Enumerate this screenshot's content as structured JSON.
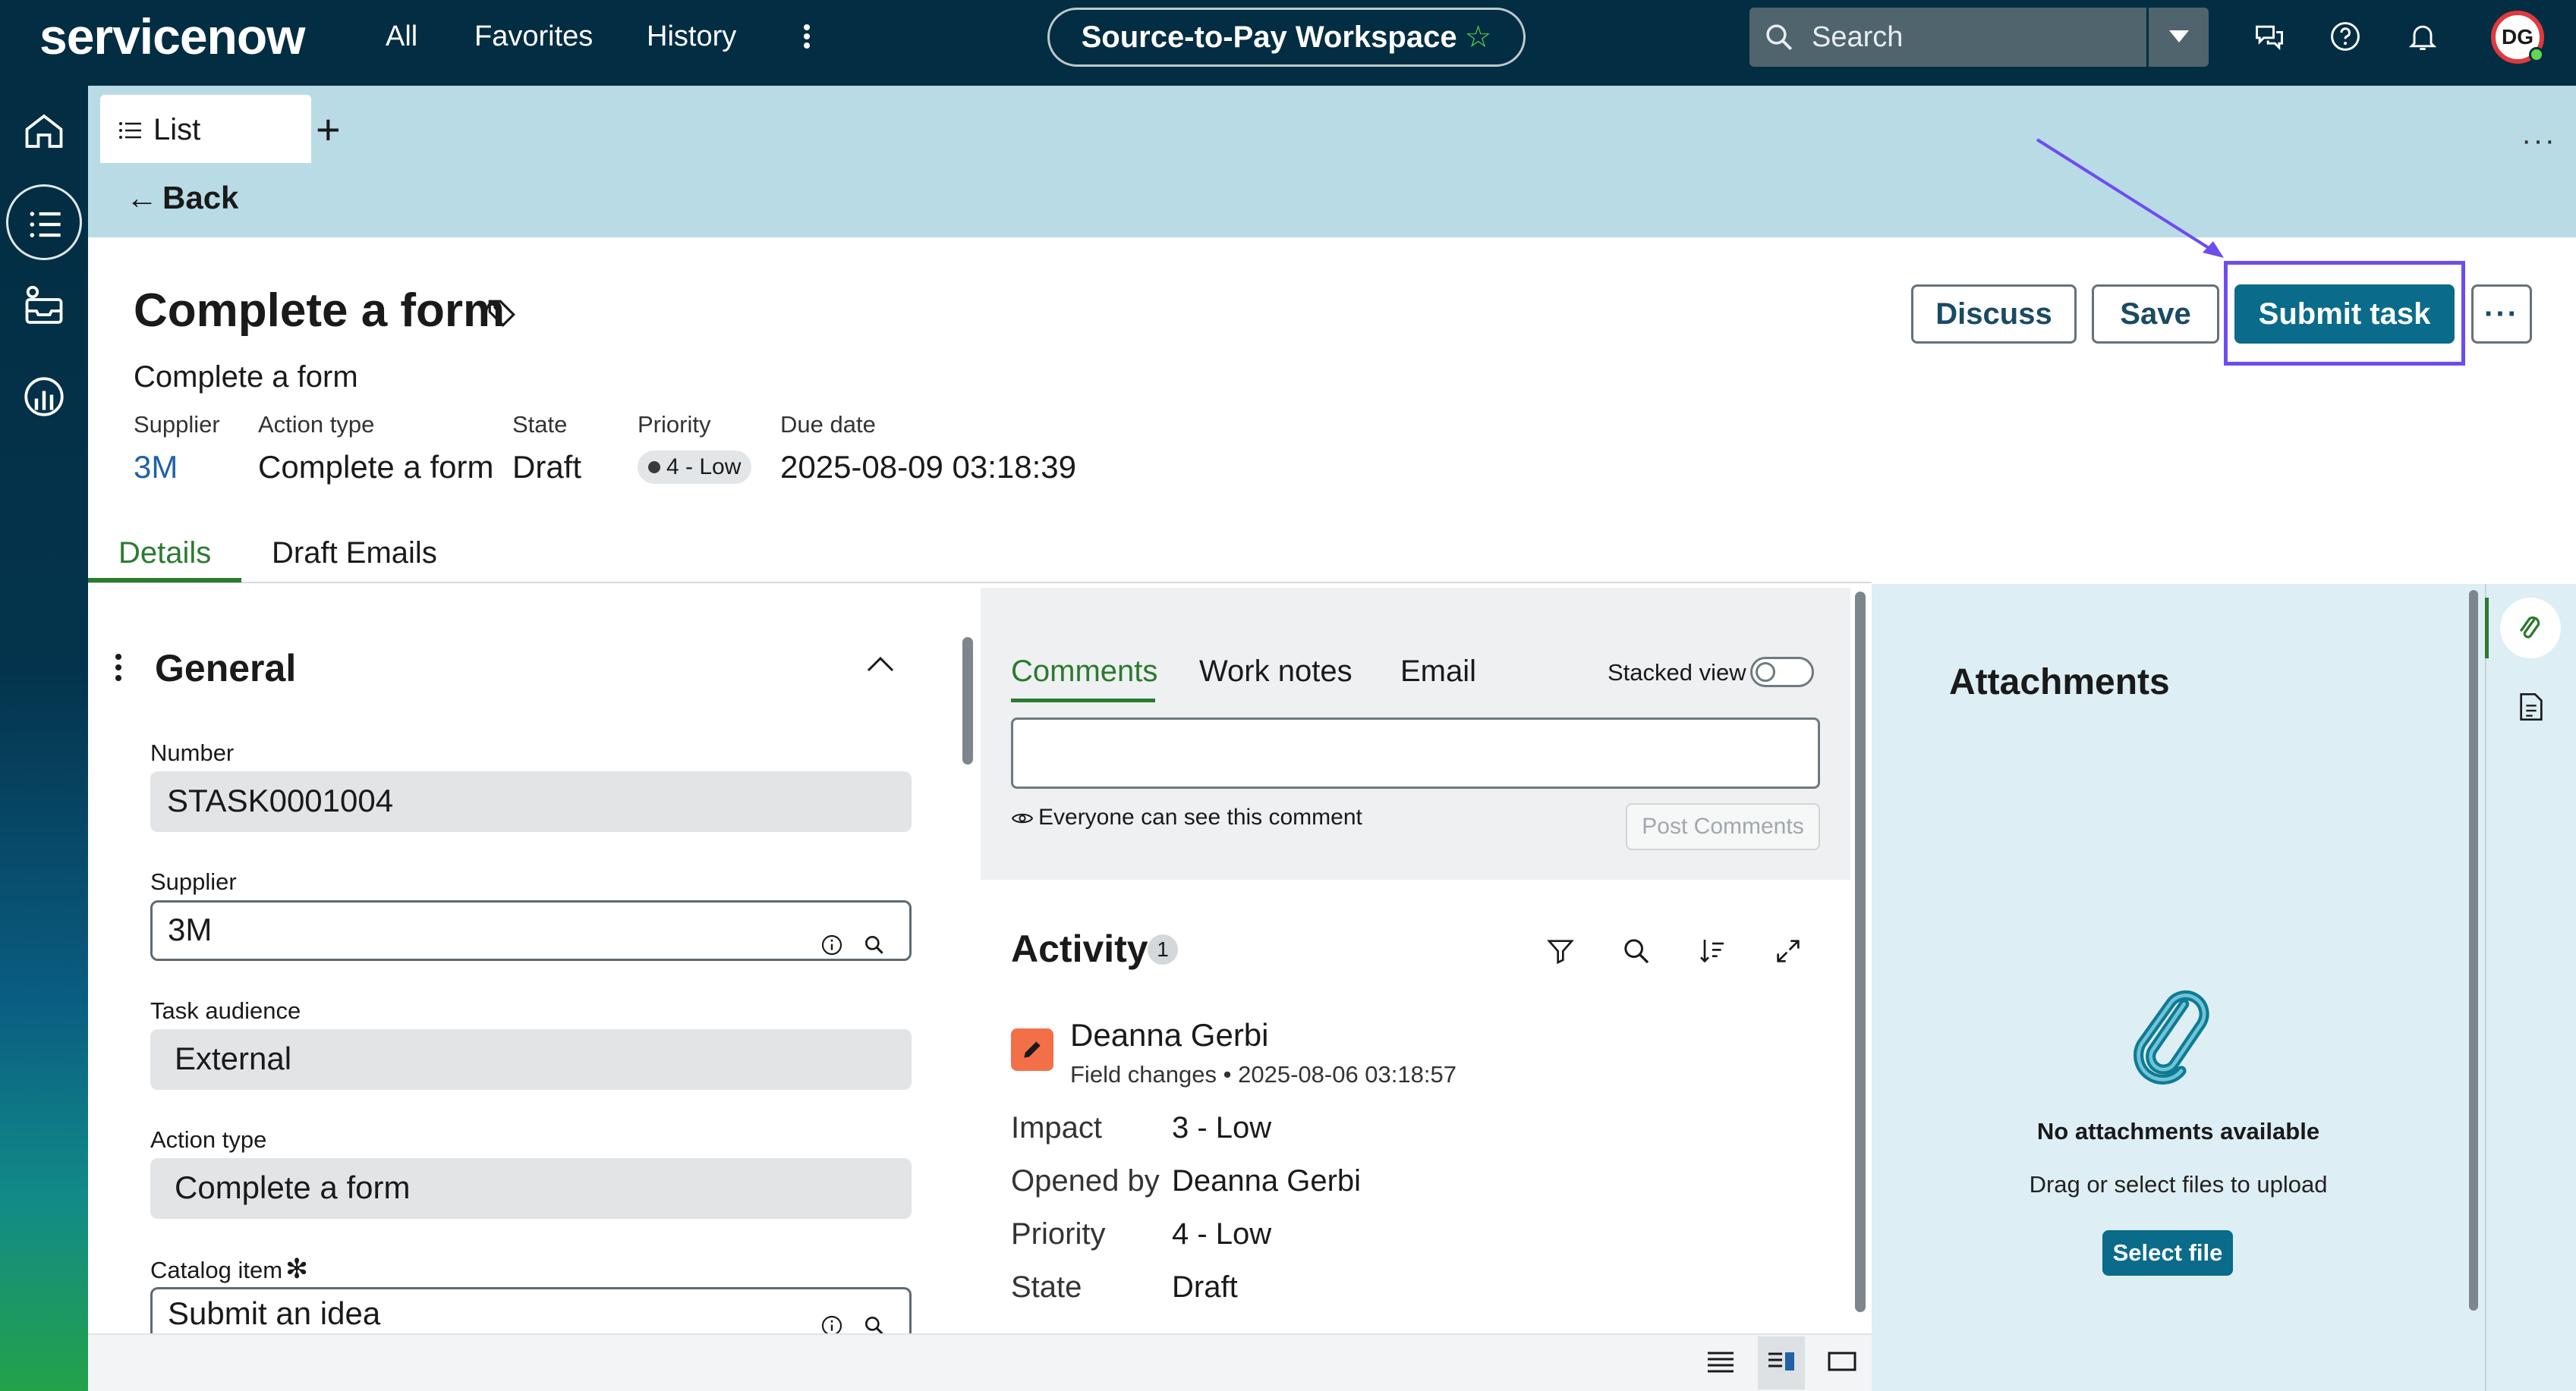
{
  "topbar": {
    "logo": "servicenow",
    "nav": [
      "All",
      "Favorites",
      "History"
    ],
    "workspace": "Source-to-Pay Workspace",
    "search_placeholder": "Search",
    "avatar_initials": "DG"
  },
  "tabs": {
    "list_label": "List",
    "back_label": "Back"
  },
  "record": {
    "title": "Complete a form",
    "subtitle": "Complete a form",
    "meta": [
      {
        "label": "Supplier",
        "value": "3M"
      },
      {
        "label": "Action type",
        "value": "Complete a form"
      },
      {
        "label": "State",
        "value": "Draft"
      },
      {
        "label": "Priority",
        "value": "4 - Low"
      },
      {
        "label": "Due date",
        "value": "2025-08-09 03:18:39"
      }
    ]
  },
  "actions": {
    "discuss": "Discuss",
    "save": "Save",
    "submit": "Submit task"
  },
  "form_tabs": [
    "Details",
    "Draft Emails"
  ],
  "general": {
    "title": "General",
    "fields": [
      {
        "label": "Number",
        "value": "STASK0001004"
      },
      {
        "label": "Supplier",
        "value": "3M"
      },
      {
        "label": "Task audience",
        "value": "External"
      },
      {
        "label": "Action type",
        "value": "Complete a form"
      },
      {
        "label": "Catalog item",
        "value": "Submit an idea"
      }
    ]
  },
  "comments": {
    "tabs": [
      "Comments",
      "Work notes",
      "Email"
    ],
    "stacked_view": "Stacked view",
    "visibility": "Everyone can see this comment",
    "post_label": "Post Comments"
  },
  "activity": {
    "title": "Activity",
    "count": "1",
    "entry": {
      "author": "Deanna Gerbi",
      "type": "Field changes",
      "timestamp": "2025-08-06 03:18:57",
      "changes": [
        {
          "field": "Impact",
          "value": "3 - Low"
        },
        {
          "field": "Opened by",
          "value": "Deanna Gerbi"
        },
        {
          "field": "Priority",
          "value": "4 - Low"
        },
        {
          "field": "State",
          "value": "Draft"
        }
      ]
    }
  },
  "attachments": {
    "title": "Attachments",
    "empty": "No attachments available",
    "hint": "Drag or select files to upload",
    "select_label": "Select file"
  },
  "colors": {
    "header_bg": "#032d42",
    "tabstrip_bg": "#b9dbe6",
    "primary": "#0a6b8a",
    "active_tab": "#2b7a2f",
    "highlight": "#6e4cf0",
    "attachments_bg": "#ddeef4"
  }
}
